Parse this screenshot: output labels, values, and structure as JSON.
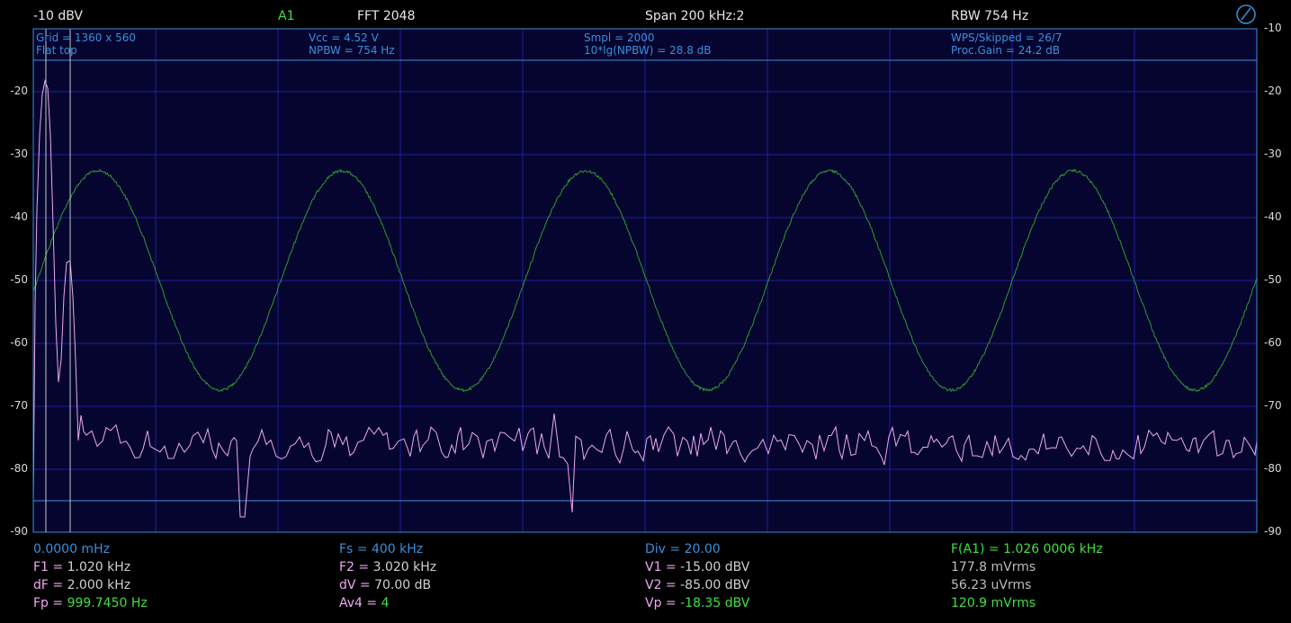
{
  "header": {
    "ref_level": "-10 dBV",
    "channel": "A1",
    "fft": "FFT  2048",
    "span": "Span 200 kHz:2",
    "rbw": "RBW 754 Hz",
    "gauge_icon": "dial-gauge-icon"
  },
  "info": {
    "grid": "Grid = 1360 x 560",
    "window": "Flat top",
    "vcc": "Vcc = 4.52 V",
    "npbw": "NPBW = 754 Hz",
    "smpl": "Smpl = 2000",
    "npbw_db": "10*lg(NPBW) = 28.8 dB",
    "wps": "WPS/Skipped  = 26/7",
    "proc_gain": "Proc.Gain = 24.2 dB"
  },
  "axis": {
    "left_ticks": [
      "-20",
      "-30",
      "-40",
      "-50",
      "-60",
      "-70",
      "-80",
      "-90"
    ],
    "right_ticks": [
      "-10",
      "-20",
      "-30",
      "-40",
      "-50",
      "-60",
      "-70",
      "-80",
      "-90"
    ]
  },
  "footer": {
    "row1": {
      "c1": "0.0000 mHz",
      "c2": "Fs = 400 kHz",
      "c3": "Div = 20.00",
      "c4": "F(A1) = 1.026 0006 kHz"
    },
    "row2": {
      "c1_label": "F1 = ",
      "c1_value": "1.020 kHz",
      "c2_label": "F2 = ",
      "c2_value": "3.020 kHz",
      "c3_label": "V1 = ",
      "c3_value": "-15.00 dBV",
      "c4": "177.8 mVrms"
    },
    "row3": {
      "c1_label": "dF = ",
      "c1_value": "2.000 kHz",
      "c2_label": "dV = ",
      "c2_value": "70.00 dB",
      "c3_label": "V2 = ",
      "c3_value": "-85.00 dBV",
      "c4": "56.23 uVrms"
    },
    "row4": {
      "c1_label": "Fp = ",
      "c1_value": "999.7450 Hz",
      "c2_label": "Av4 = ",
      "c2_value": "4",
      "c3_label": "Vp = ",
      "c3_value": "-18.35 dBV",
      "c4": "120.9 mVrms"
    }
  },
  "colors": {
    "background": "#000000",
    "plot_bg": "#050530",
    "grid": "#1f1fa0",
    "border": "#3a8fd8",
    "spectrum": "#f0a8f0",
    "waveform": "#2e9a2e",
    "cursor": "#c8c8c8"
  }
}
